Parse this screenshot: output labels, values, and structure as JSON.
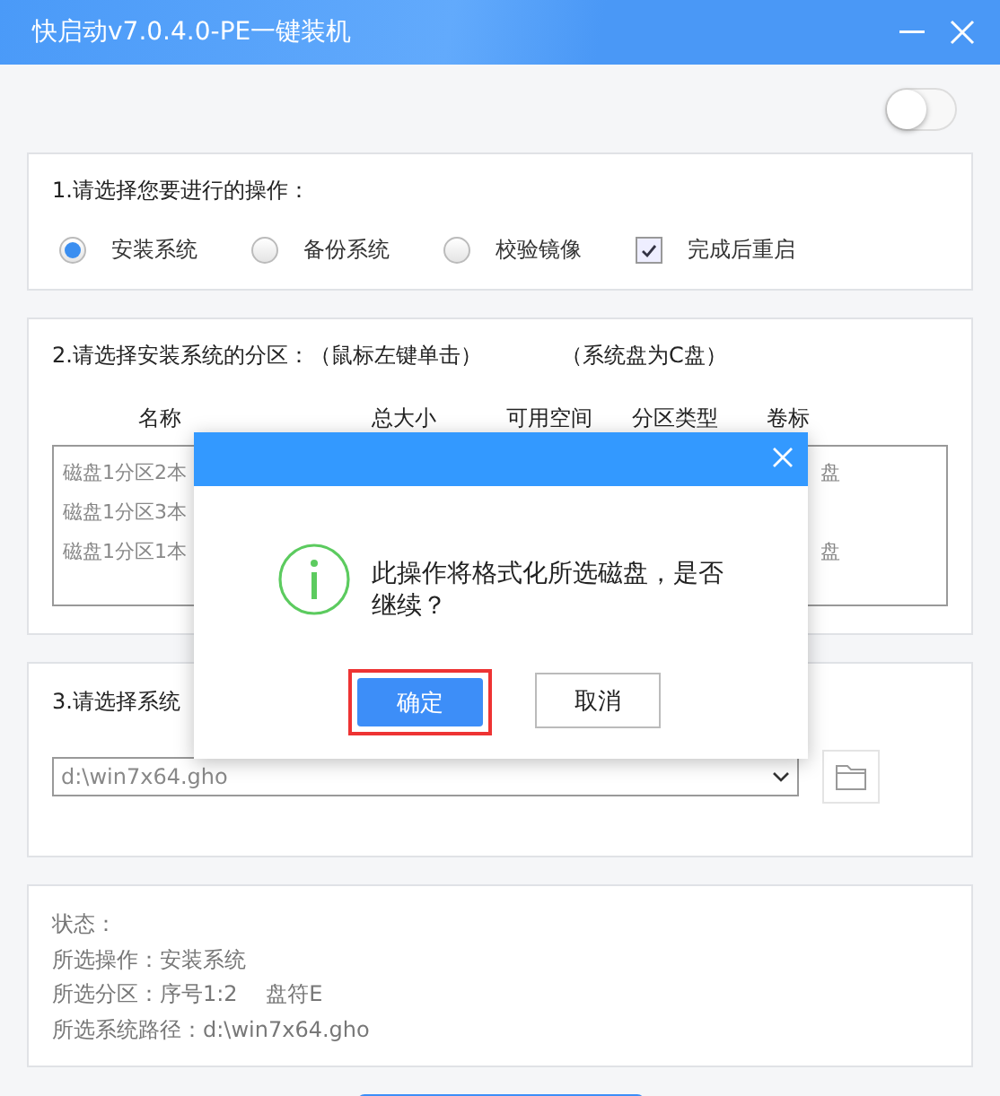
{
  "window": {
    "title": "快启动v7.0.4.0-PE一键装机"
  },
  "toggle": {
    "on": false
  },
  "operation": {
    "title": "1.请选择您要进行的操作：",
    "options": [
      {
        "label": "安装系统",
        "selected": true
      },
      {
        "label": "备份系统",
        "selected": false
      },
      {
        "label": "校验镜像",
        "selected": false
      }
    ],
    "reboot": {
      "label": "完成后重启",
      "checked": true
    }
  },
  "partition": {
    "title": "2.请选择安装系统的分区：（鼠标左键单击）",
    "note": "（系统盘为C盘）",
    "columns": [
      "名称",
      "总大小",
      "可用空间",
      "分区类型",
      "卷标"
    ],
    "rows": [
      {
        "name": "磁盘1分区2本",
        "label": "盘"
      },
      {
        "name": "磁盘1分区3本"
      },
      {
        "name": "磁盘1分区1本",
        "label": "盘"
      }
    ]
  },
  "image": {
    "title": "3.请选择系统",
    "path": "d:\\win7x64.gho"
  },
  "status": {
    "lines": [
      "状态：",
      "所选操作：安装系统",
      "所选分区：序号1:2　 盘符E",
      "所选系统路径：d:\\win7x64.gho"
    ]
  },
  "dialog": {
    "message": "此操作将格式化所选磁盘，是否继续？",
    "buttons": [
      {
        "label": "确定",
        "kind": "primary"
      },
      {
        "label": "取消",
        "kind": "secondary"
      }
    ]
  }
}
